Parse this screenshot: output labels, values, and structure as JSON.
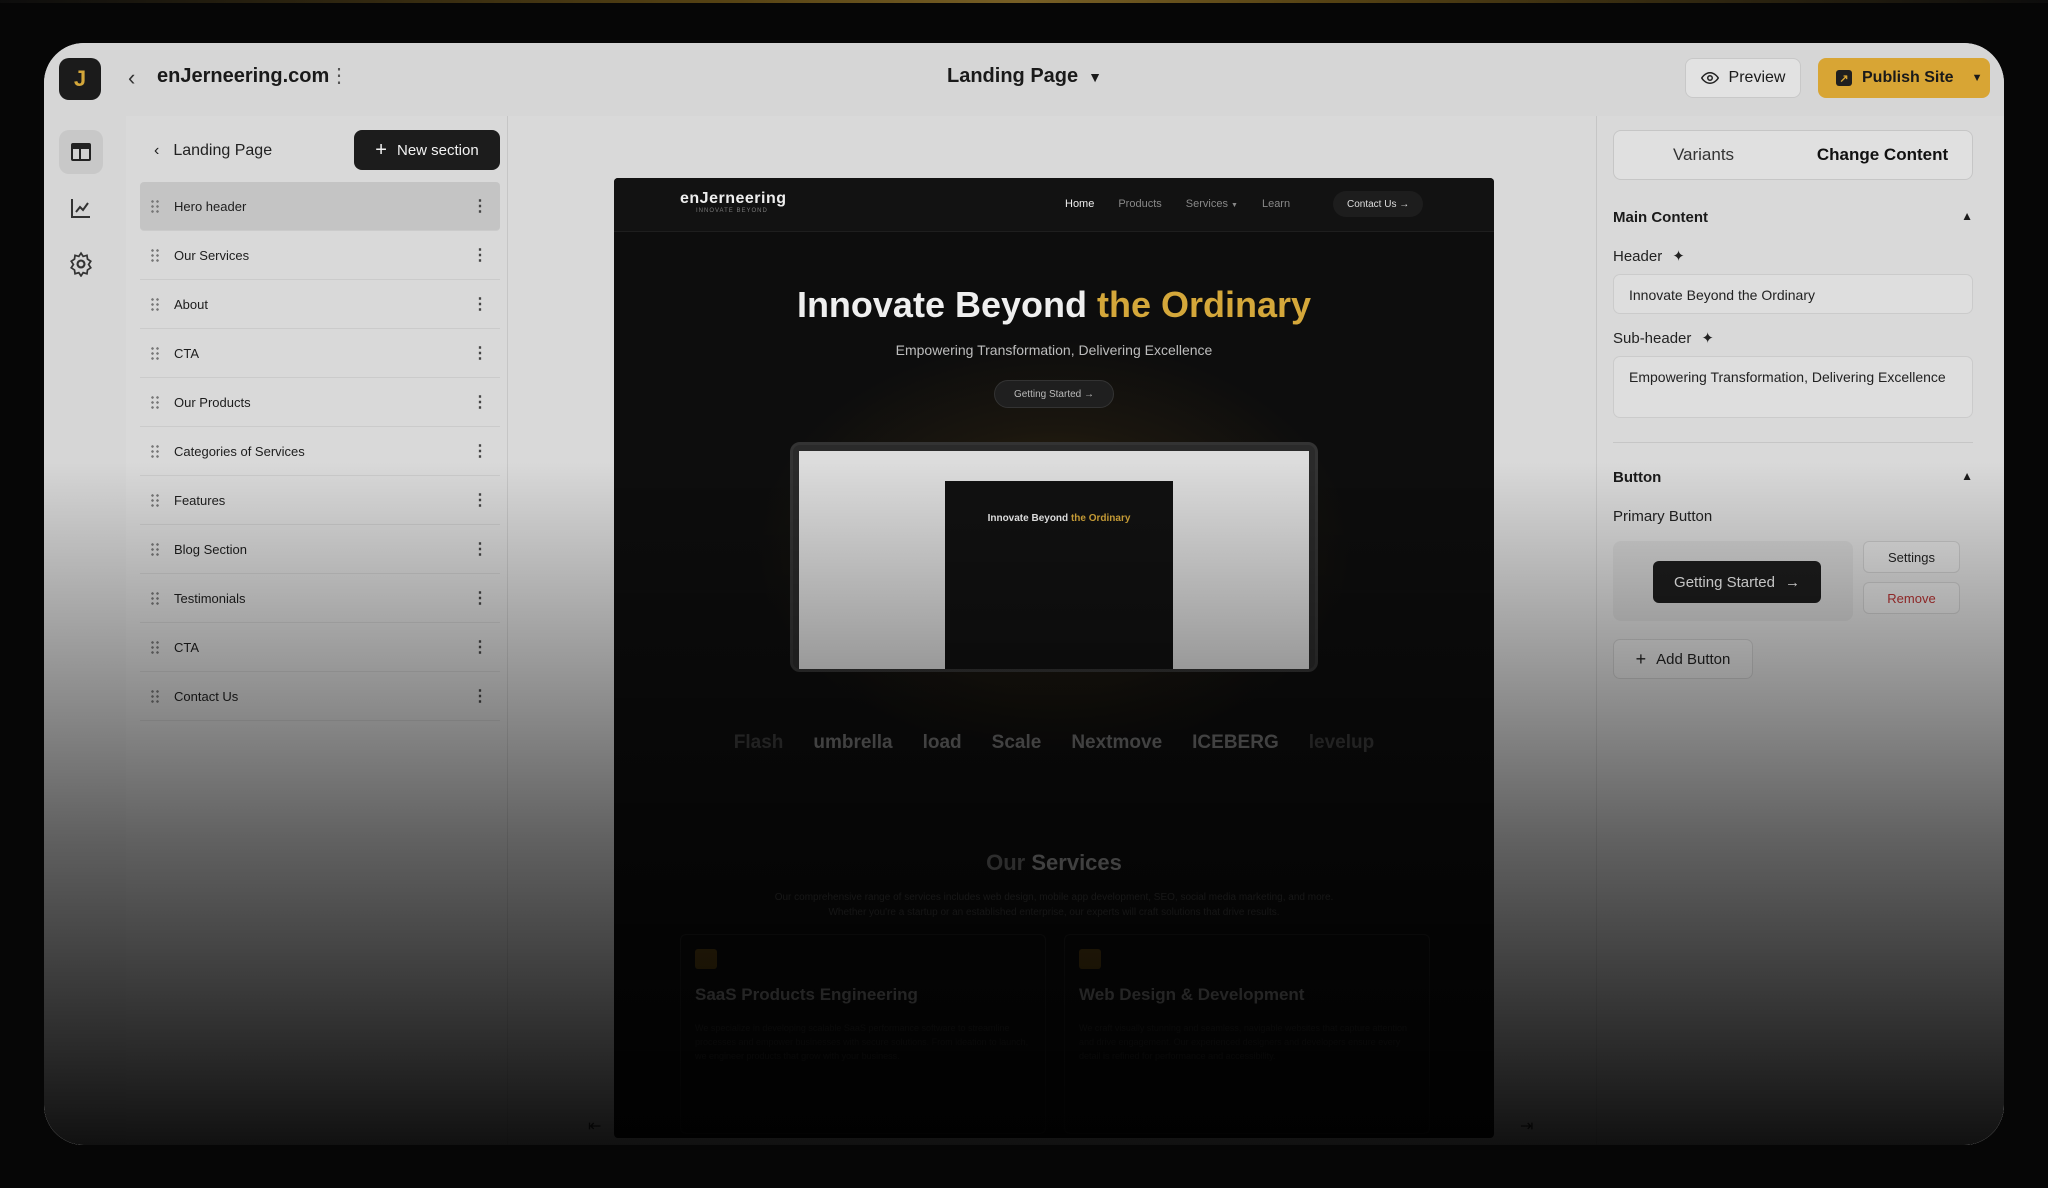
{
  "topbar": {
    "logo_letter": "J",
    "site_name": "enJerneering.com",
    "page_selector": "Landing Page",
    "preview_label": "Preview",
    "publish_label": "Publish Site"
  },
  "rail": {
    "items": [
      {
        "icon": "layout-icon"
      },
      {
        "icon": "analytics-icon"
      },
      {
        "icon": "settings-gear-icon"
      }
    ]
  },
  "sections_panel": {
    "title": "Landing Page",
    "new_section_label": "New section",
    "items": [
      {
        "label": "Hero header"
      },
      {
        "label": "Our Services"
      },
      {
        "label": "About"
      },
      {
        "label": "CTA"
      },
      {
        "label": "Our Products"
      },
      {
        "label": "Categories of Services"
      },
      {
        "label": "Features"
      },
      {
        "label": "Blog Section"
      },
      {
        "label": "Testimonials"
      },
      {
        "label": "CTA"
      },
      {
        "label": "Contact Us"
      }
    ]
  },
  "preview_site": {
    "logo": "enJerneering",
    "logo_tagline": "INNOVATE BEYOND",
    "nav": [
      "Home",
      "Products",
      "Services",
      "Learn"
    ],
    "contact_label": "Contact Us →",
    "hero_title_main": "Innovate Beyond",
    "hero_title_accent": "the Ordinary",
    "hero_subtitle": "Empowering Transformation, Delivering Excellence",
    "hero_button": "Getting Started →",
    "mock_title_main": "Innovate Beyond",
    "mock_title_accent": "the Ordinary",
    "logos": [
      "Flash",
      "umbrella",
      "load",
      "Scale",
      "Nextmove",
      "ICEBERG",
      "levelup"
    ],
    "services_title_dim": "Our",
    "services_title": "Services",
    "services_desc": "Our comprehensive range of services includes web design, mobile app development, SEO, social media marketing, and more. Whether you're a startup or an established enterprise, our experts will craft solutions that drive results.",
    "cards": [
      {
        "title": "SaaS Products Engineering",
        "text": "We specialize in developing scalable SaaS performance software to streamline processes and empower businesses with secure solutions. From ideation to launch, we engineer products that grow with your business."
      },
      {
        "title": "Web Design & Development",
        "text": "We craft visually stunning and seamless, navigable websites that capture attention and drive engagement. Our experienced designers and developers ensure every detail is refined for performance and accessibility."
      }
    ]
  },
  "right_panel": {
    "tabs": [
      "Variants",
      "Change Content"
    ],
    "active_tab": "Change Content",
    "main_content_title": "Main Content",
    "header_label": "Header",
    "header_value": "Innovate Beyond the Ordinary",
    "subheader_label": "Sub-header",
    "subheader_value": "Empowering Transformation, Delivering Excellence",
    "button_section_title": "Button",
    "primary_button_label": "Primary Button",
    "primary_button_text": "Getting Started",
    "settings_label": "Settings",
    "remove_label": "Remove",
    "add_button_label": "Add Button"
  },
  "colors": {
    "accent": "#d4a73a",
    "publish_bg": "#d8a534",
    "remove_text": "#b03030"
  }
}
